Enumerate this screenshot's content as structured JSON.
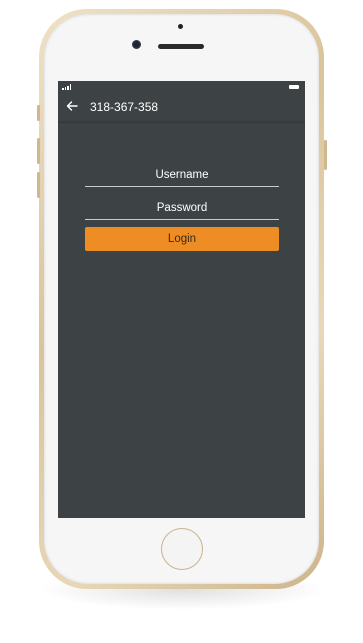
{
  "app_bar": {
    "title": "318-367-358",
    "back_icon": "arrow-left-icon"
  },
  "login_form": {
    "username_placeholder": "Username",
    "password_placeholder": "Password",
    "login_label": "Login"
  },
  "status_bar": {
    "signal_icon": "signal-bars-icon",
    "battery_icon": "battery-icon"
  },
  "colors": {
    "screen_background": "#3d4344",
    "accent": "#ef8d25",
    "text": "#ffffff",
    "phone_frame": "#d9c49b"
  }
}
